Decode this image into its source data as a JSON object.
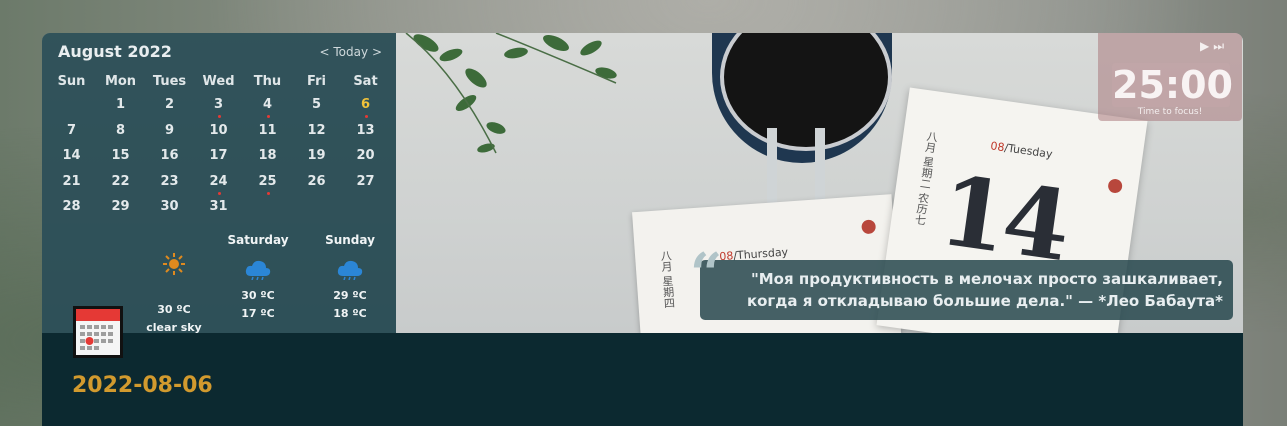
{
  "calendar": {
    "month_title": "August 2022",
    "nav_prev": "<",
    "nav_today": "Today",
    "nav_next": ">",
    "weekdays": [
      "Sun",
      "Mon",
      "Tues",
      "Wed",
      "Thu",
      "Fri",
      "Sat"
    ],
    "leading_blank_days": 1,
    "days": [
      "1",
      "2",
      "3",
      "4",
      "5",
      "6",
      "7",
      "8",
      "9",
      "10",
      "11",
      "12",
      "13",
      "14",
      "15",
      "16",
      "17",
      "18",
      "19",
      "20",
      "21",
      "22",
      "23",
      "24",
      "25",
      "26",
      "27",
      "28",
      "29",
      "30",
      "31"
    ],
    "today": "6",
    "event_days": [
      "3",
      "4",
      "6",
      "24",
      "25"
    ],
    "today_color": "#f0c23a",
    "event_dot_color": "#e53935"
  },
  "weather": [
    {
      "name": "",
      "icon": "sun-icon",
      "temp": "30 ºC",
      "desc": "clear sky"
    },
    {
      "name": "Saturday",
      "icon": "cloud-rain-icon",
      "temp": "30 ºC",
      "temp2": "17 ºC"
    },
    {
      "name": "Sunday",
      "icon": "cloud-rain-icon",
      "temp": "29 ºC",
      "temp2": "18 ºC"
    }
  ],
  "timer": {
    "time": "25:00",
    "label": "Time to focus!",
    "play_icon": "play-icon",
    "skip_icon": "skip-next-icon"
  },
  "quote": {
    "mark": "“",
    "text": "\"Моя продуктивность в мелочах просто зашкаливает, когда я откладываю большие дела.\" — *Лео Бабаута*"
  },
  "photo": {
    "page_back_date_num": "08",
    "page_back_day": "Thursday",
    "page_front_date_num": "08",
    "page_front_day": "Tuesday",
    "page_front_big_number": "14",
    "page_side_text_1": "八月 星期四",
    "page_side_text_2": "八月 星期二 农历七"
  },
  "main": {
    "date_heading": "2022-08-06"
  },
  "colors": {
    "card_background": "#0c2930",
    "accent_date": "#d29a2e",
    "timer_tint": "#a97a7e"
  }
}
